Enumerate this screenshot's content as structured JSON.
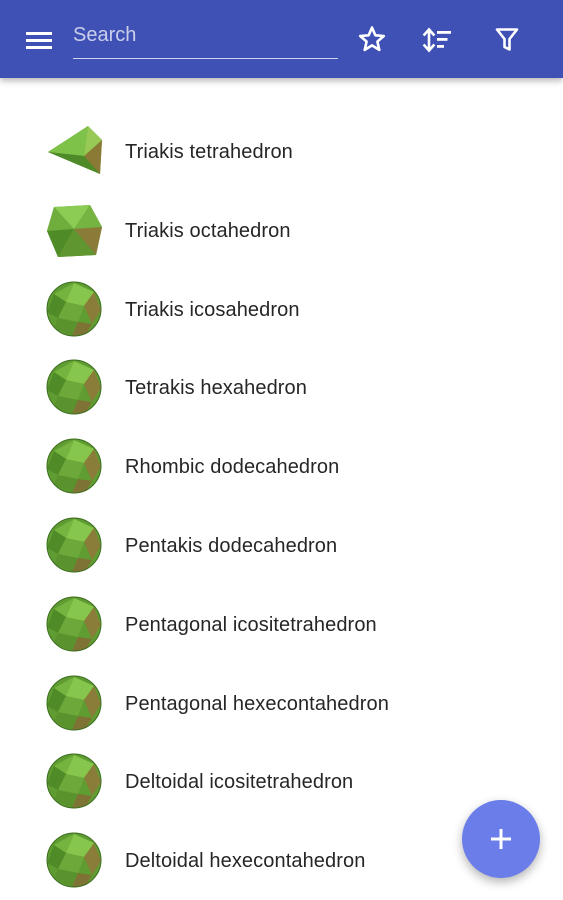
{
  "appbar": {
    "color": "#3f51b5",
    "menu_icon": "hamburger-menu-icon",
    "search": {
      "placeholder": "Search",
      "value": ""
    },
    "actions": [
      {
        "icon": "star-outline-icon",
        "label": "Favorites"
      },
      {
        "icon": "sort-icon",
        "label": "Sort"
      },
      {
        "icon": "filter-icon",
        "label": "Filter"
      }
    ]
  },
  "list": {
    "items": [
      {
        "label": "Triakis tetrahedron",
        "thumbnail": "polyhedron-icon"
      },
      {
        "label": "Triakis octahedron",
        "thumbnail": "polyhedron-icon"
      },
      {
        "label": "Triakis icosahedron",
        "thumbnail": "polyhedron-icon"
      },
      {
        "label": "Tetrakis hexahedron",
        "thumbnail": "polyhedron-icon"
      },
      {
        "label": "Rhombic dodecahedron",
        "thumbnail": "polyhedron-icon"
      },
      {
        "label": "Pentakis dodecahedron",
        "thumbnail": "polyhedron-icon"
      },
      {
        "label": "Pentagonal icositetrahedron",
        "thumbnail": "polyhedron-icon"
      },
      {
        "label": "Pentagonal hexecontahedron",
        "thumbnail": "polyhedron-icon"
      },
      {
        "label": "Deltoidal icositetrahedron",
        "thumbnail": "polyhedron-icon"
      },
      {
        "label": "Deltoidal hexecontahedron",
        "thumbnail": "polyhedron-icon"
      }
    ]
  },
  "fab": {
    "icon": "plus-icon",
    "color": "#6a7de8"
  },
  "colors": {
    "polyhedron_green": "#6ca83a",
    "text": "#262626"
  }
}
